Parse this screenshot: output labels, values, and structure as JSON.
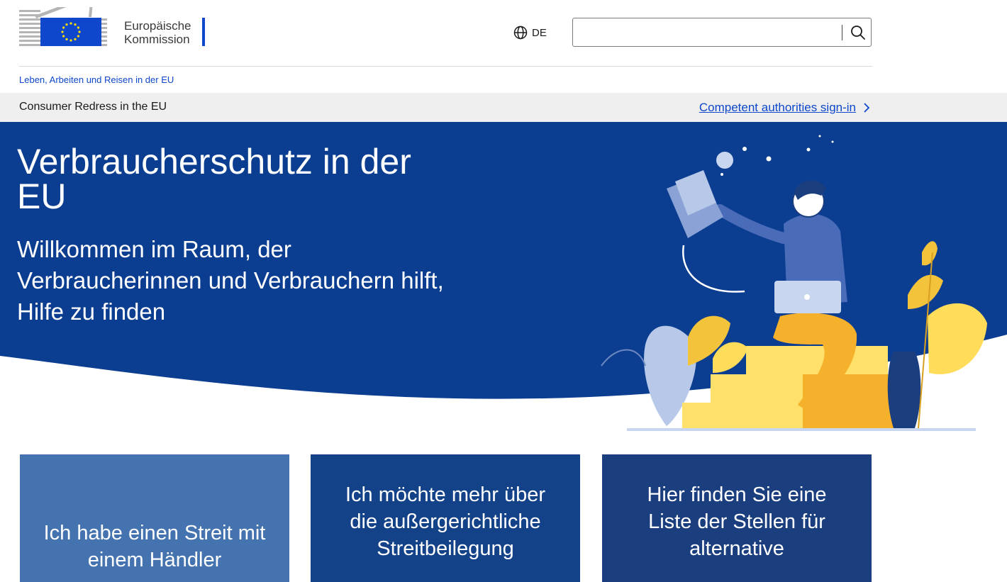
{
  "header": {
    "logo_line1": "Europäische",
    "logo_line2": "Kommission",
    "language": "DE",
    "search": {
      "value": "",
      "placeholder": ""
    }
  },
  "breadcrumb": {
    "site_link": "Leben, Arbeiten und Reisen in der EU"
  },
  "subbar": {
    "site_title": "Consumer Redress in the EU",
    "signin_link": "Competent authorities sign-in"
  },
  "hero": {
    "title": "Verbraucherschutz in der EU",
    "subtitle": "Willkommen im Raum, der Verbraucherinnen und Verbrauchern hilft, Hilfe zu finden"
  },
  "cards": [
    {
      "label": "Ich habe einen Streit mit einem Händler"
    },
    {
      "label": "Ich möchte mehr über die außergerichtliche Streitbeilegung"
    },
    {
      "label": "Hier finden Sie eine Liste der Stellen für alternative"
    }
  ],
  "colors": {
    "eu_blue": "#0e47cb",
    "hero_blue": "#0b3d91",
    "card_1": "#4573b0",
    "card_2": "#134289",
    "card_3": "#1b3e7e"
  }
}
